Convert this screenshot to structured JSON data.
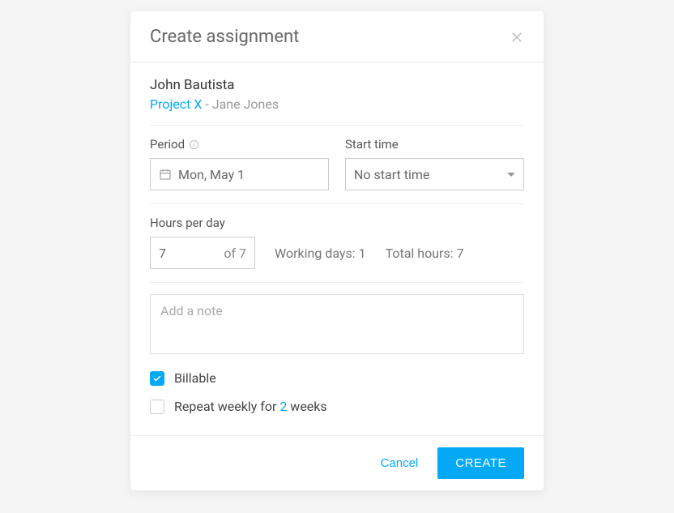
{
  "header": {
    "title": "Create assignment"
  },
  "assignee": {
    "name": "John Bautista",
    "project": "Project X",
    "separator": " - ",
    "manager": "Jane Jones"
  },
  "period": {
    "label": "Period",
    "value": "Mon, May 1"
  },
  "start_time": {
    "label": "Start time",
    "value": "No start time"
  },
  "hours": {
    "label": "Hours per day",
    "value": "7",
    "suffix": "of 7",
    "working_days_label": "Working days:",
    "working_days_value": "1",
    "total_hours_label": "Total hours:",
    "total_hours_value": "7"
  },
  "note": {
    "placeholder": "Add a note",
    "value": ""
  },
  "billable": {
    "label": "Billable",
    "checked": true
  },
  "repeat": {
    "prefix": "Repeat weekly for ",
    "count": "2",
    "suffix": " weeks",
    "checked": false
  },
  "footer": {
    "cancel": "Cancel",
    "create": "CREATE"
  }
}
